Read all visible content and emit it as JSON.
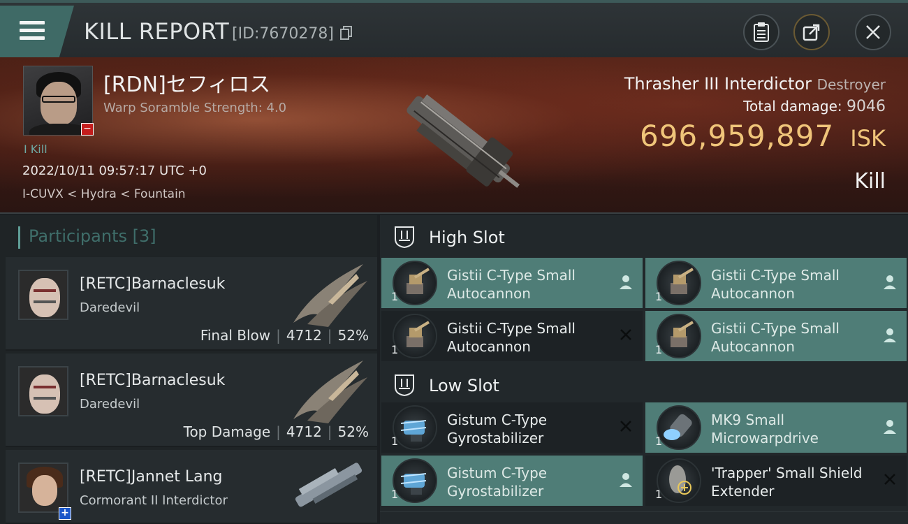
{
  "header": {
    "title": "KILL REPORT",
    "report_id": "[ID:7670278]"
  },
  "victim": {
    "name": "[RDN]セフィロス",
    "subtitle": "Warp Soramble Strength: 4.0",
    "kill_count": "I Kill",
    "datetime": "2022/10/11 09:57:17 UTC +0",
    "location": "I-CUVX < Hydra < Fountain",
    "ship_name": "Thrasher III Interdictor",
    "ship_class": "Destroyer",
    "total_damage_label": "Total damage:",
    "total_damage": "9046",
    "isk_value": "696,959,897",
    "isk_unit": "ISK",
    "result": "Kill"
  },
  "participants": {
    "heading": "Participants",
    "count": "[3]",
    "rows": [
      {
        "name": "[RETC]Barnaclesuk",
        "ship": "Daredevil",
        "role": "Final Blow",
        "damage": "4712",
        "percent": "52%"
      },
      {
        "name": "[RETC]Barnaclesuk",
        "ship": "Daredevil",
        "role": "Top Damage",
        "damage": "4712",
        "percent": "52%"
      },
      {
        "name": "[RETC]Jannet Lang",
        "ship": "Cormorant II Interdictor"
      }
    ]
  },
  "fitting": {
    "high_slot_label": "High Slot",
    "low_slot_label": "Low Slot",
    "high_modules": [
      {
        "name": "Gistii C-Type Small Autocannon",
        "qty": "1",
        "status": "fitted"
      },
      {
        "name": "Gistii C-Type Small Autocannon",
        "qty": "1",
        "status": "fitted"
      },
      {
        "name": "Gistii C-Type Small Autocannon",
        "qty": "1",
        "status": "destroyed"
      },
      {
        "name": "Gistii C-Type Small Autocannon",
        "qty": "1",
        "status": "fitted"
      }
    ],
    "low_modules": [
      {
        "name": "Gistum C-Type Gyrostabilizer",
        "qty": "1",
        "status": "destroyed"
      },
      {
        "name": "MK9 Small Microwarpdrive",
        "qty": "1",
        "status": "fitted"
      },
      {
        "name": "Gistum C-Type Gyrostabilizer",
        "qty": "1",
        "status": "fitted"
      },
      {
        "name": "'Trapper' Small Shield Extender",
        "qty": "1",
        "status": "destroyed"
      }
    ]
  },
  "colors": {
    "accent_teal": "#4f7d77",
    "isk_gold": "#f0c57a",
    "victim_banner": "#3b1a14"
  }
}
